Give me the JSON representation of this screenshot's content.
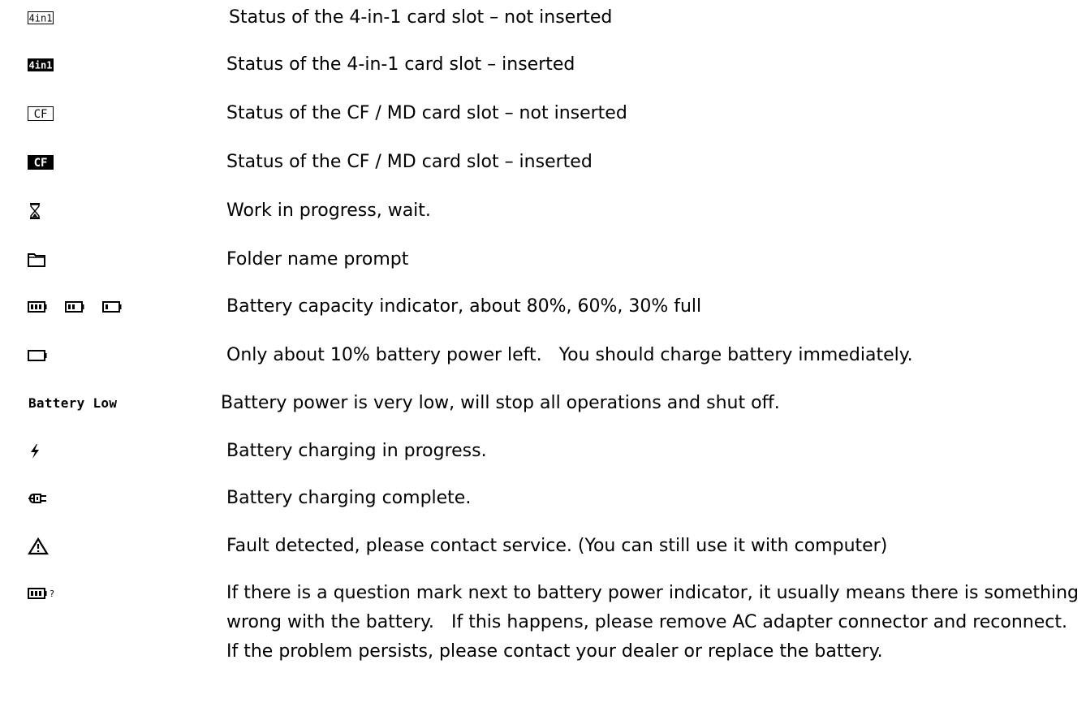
{
  "icons": {
    "r1": "4in1-slot-empty-icon",
    "r2": "4in1-slot-inserted-icon",
    "r3": "cf-slot-empty-icon",
    "r4": "cf-slot-inserted-icon",
    "r5": "hourglass-icon",
    "r6": "folder-icon",
    "r7": "battery-levels-icon",
    "r8": "battery-empty-icon",
    "r10": "lightning-icon",
    "r11": "plug-icon",
    "r12": "warning-triangle-icon",
    "r13": "battery-question-icon"
  },
  "icon_text": {
    "four_in_one": "4in1",
    "cf": "CF",
    "battery_low": "Battery Low",
    "question": "?"
  },
  "rows": [
    {
      "description": "Status of the 4-in-1 card slot – not inserted"
    },
    {
      "description": "Status of the 4-in-1 card slot – inserted"
    },
    {
      "description": "Status of the CF / MD card slot – not inserted"
    },
    {
      "description": "Status of the CF / MD card slot – inserted"
    },
    {
      "description": "Work in progress, wait."
    },
    {
      "description": "Folder name prompt"
    },
    {
      "description": "Battery capacity indicator, about 80%, 60%, 30% full"
    },
    {
      "description": "Only about 10% battery power left.   You should charge battery immediately."
    },
    {
      "description": "Battery power is very low, will stop all operations and shut off."
    },
    {
      "description": "Battery charging in progress."
    },
    {
      "description": "Battery charging complete."
    },
    {
      "description": "Fault detected, please contact service. (You can still use it with computer)"
    },
    {
      "description": "If there is a question mark next to battery power indicator, it usually means there is something wrong with the battery.   If this happens, please remove AC adapter connector and reconnect.   If the problem persists, please contact your dealer or replace the battery."
    }
  ]
}
